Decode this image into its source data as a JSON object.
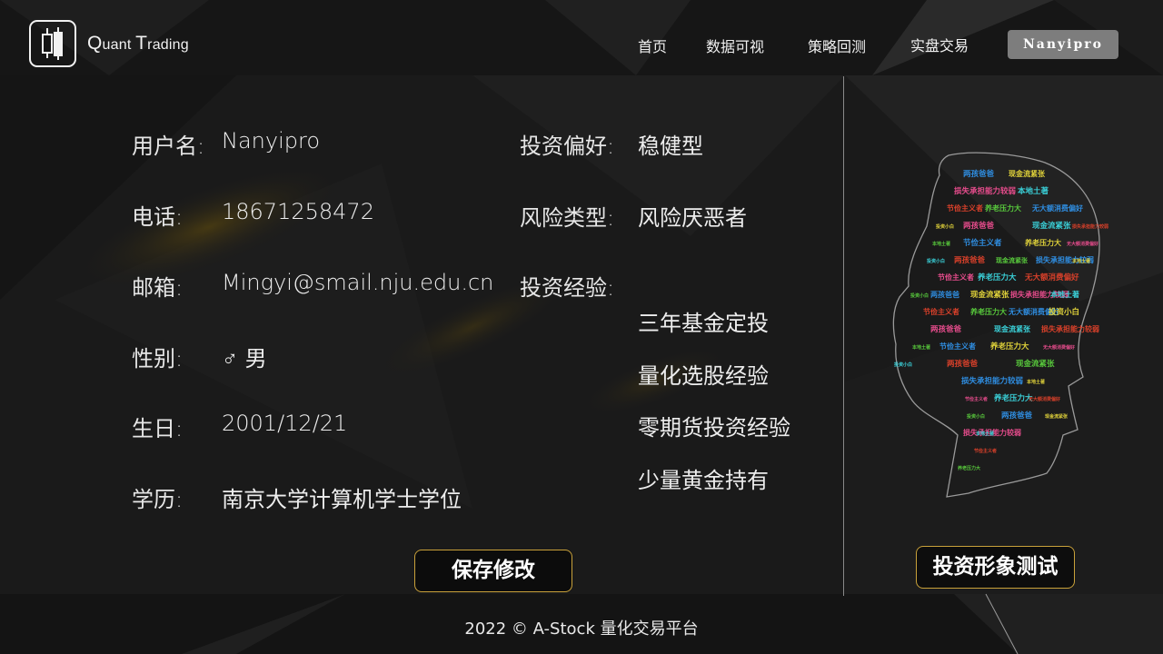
{
  "app": {
    "logo_text_q": "Q",
    "logo_text_1": "uant ",
    "logo_text_t": "T",
    "logo_text_2": "rading"
  },
  "nav": {
    "items": [
      "首页",
      "数据可视",
      "策略回测",
      "实盘交易"
    ],
    "user": "Nanyipro"
  },
  "profile": {
    "left": [
      {
        "label": "用户名:",
        "value": "Nanyipro"
      },
      {
        "label": "电话:",
        "value": "18671258472"
      },
      {
        "label": "邮箱:",
        "value": "Mingyi@smail.nju.edu.cn"
      },
      {
        "label": "性别:",
        "value": "♂ 男"
      },
      {
        "label": "生日:",
        "value": "2001/12/21"
      },
      {
        "label": "学历:",
        "value": "南京大学计算机学士学位"
      }
    ],
    "right": [
      {
        "label": "投资偏好:",
        "value": "稳健型"
      },
      {
        "label": "风险类型:",
        "value": "风险厌恶者"
      },
      {
        "label": "投资经验:",
        "value": ""
      }
    ],
    "experience": [
      "三年基金定投",
      "量化选股经验",
      "零期货投资经验",
      "少量黄金持有"
    ]
  },
  "buttons": {
    "save": "保存修改",
    "test": "投资形象测试"
  },
  "wordcloud": {
    "words": [
      "两孩爸爸",
      "本地土著",
      "无大额消费偏好",
      "现金流紧张",
      "节俭主义者",
      "投资小白",
      "损失承担能力较弱",
      "养老压力大"
    ],
    "colors": [
      "#2f8de0",
      "#e0d23a",
      "#e64c8c",
      "#3ad0d8",
      "#d8402a",
      "#58c93c"
    ]
  },
  "footer": {
    "text": "2022 © A-Stock 量化交易平台"
  }
}
